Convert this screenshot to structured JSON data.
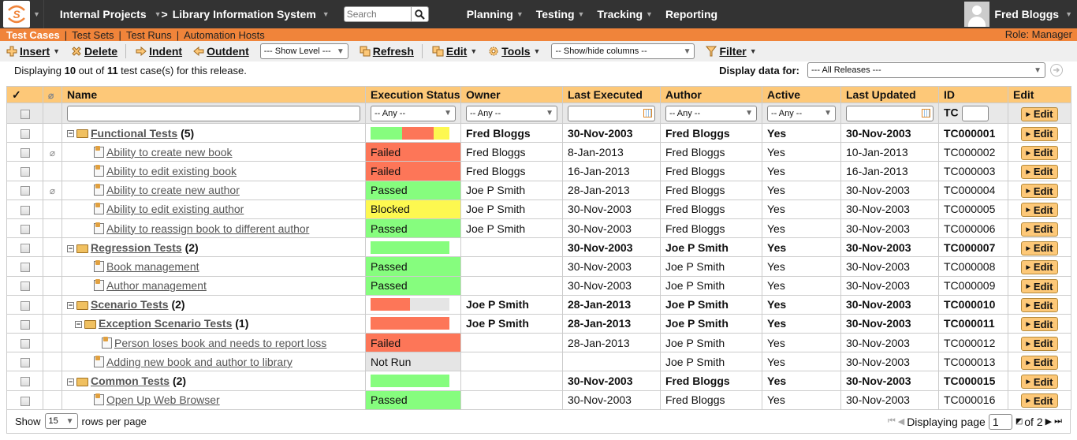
{
  "topnav": {
    "project": "Internal Projects",
    "product": "Library Information System",
    "search_placeholder": "Search",
    "menu": [
      "Planning",
      "Testing",
      "Tracking",
      "Reporting"
    ],
    "user_name": "Fred Bloggs"
  },
  "subnav": {
    "tabs": [
      "Test Cases",
      "Test Sets",
      "Test Runs",
      "Automation Hosts"
    ],
    "active_tab": "Test Cases",
    "role": "Role: Manager"
  },
  "toolbar": {
    "insert": "Insert",
    "delete": "Delete",
    "indent": "Indent",
    "outdent": "Outdent",
    "show_level": "--- Show Level ---",
    "refresh": "Refresh",
    "edit": "Edit",
    "tools": "Tools",
    "show_hide_columns": "-- Show/hide columns --",
    "filter": "Filter"
  },
  "info": {
    "prefix": "Displaying ",
    "shown": "10",
    "middle": " out of ",
    "total": "11",
    "suffix": " test case(s) for this release.",
    "display_data_for_label": "Display data for:",
    "release_select": "--- All Releases ---"
  },
  "grid": {
    "columns": [
      "✓",
      "",
      "Name",
      "Execution Status",
      "Owner",
      "Last Executed",
      "Author",
      "Active",
      "Last Updated",
      "ID",
      "Edit"
    ],
    "filters": {
      "status": "-- Any --",
      "owner": "-- Any --",
      "author": "-- Any --",
      "active": "-- Any --",
      "id_prefix": "TC",
      "edit": "Edit"
    },
    "colors": {
      "passed": "#86fd7e",
      "failed": "#fd7658",
      "blocked": "#fdf850",
      "not_run": "#e5e5e5"
    },
    "rows": [
      {
        "type": "folder",
        "level": 0,
        "name": "Functional Tests",
        "count": "(5)",
        "attach": false,
        "status_bar": [
          {
            "s": "passed",
            "pct": 40
          },
          {
            "s": "failed",
            "pct": 40
          },
          {
            "s": "blocked",
            "pct": 20
          }
        ],
        "owner": "Fred Bloggs",
        "last_executed": "30-Nov-2003",
        "author": "Fred Bloggs",
        "active": "Yes",
        "last_updated": "30-Nov-2003",
        "id": "TC000001"
      },
      {
        "type": "test",
        "level": 1,
        "name": "Ability to create new book",
        "attach": true,
        "status": "Failed",
        "status_key": "failed",
        "owner": "Fred Bloggs",
        "last_executed": "8-Jan-2013",
        "author": "Fred Bloggs",
        "active": "Yes",
        "last_updated": "10-Jan-2013",
        "id": "TC000002"
      },
      {
        "type": "test",
        "level": 1,
        "name": "Ability to edit existing book",
        "attach": false,
        "status": "Failed",
        "status_key": "failed",
        "owner": "Fred Bloggs",
        "last_executed": "16-Jan-2013",
        "author": "Fred Bloggs",
        "active": "Yes",
        "last_updated": "16-Jan-2013",
        "id": "TC000003"
      },
      {
        "type": "test",
        "level": 1,
        "name": "Ability to create new author",
        "attach": true,
        "status": "Passed",
        "status_key": "passed",
        "owner": "Joe P Smith",
        "last_executed": "28-Jan-2013",
        "author": "Fred Bloggs",
        "active": "Yes",
        "last_updated": "30-Nov-2003",
        "id": "TC000004"
      },
      {
        "type": "test",
        "level": 1,
        "name": "Ability to edit existing author",
        "attach": false,
        "status": "Blocked",
        "status_key": "blocked",
        "owner": "Joe P Smith",
        "last_executed": "30-Nov-2003",
        "author": "Fred Bloggs",
        "active": "Yes",
        "last_updated": "30-Nov-2003",
        "id": "TC000005"
      },
      {
        "type": "test",
        "level": 1,
        "name": "Ability to reassign book to different author",
        "attach": false,
        "status": "Passed",
        "status_key": "passed",
        "owner": "Joe P Smith",
        "last_executed": "30-Nov-2003",
        "author": "Fred Bloggs",
        "active": "Yes",
        "last_updated": "30-Nov-2003",
        "id": "TC000006"
      },
      {
        "type": "folder",
        "level": 0,
        "name": "Regression Tests",
        "count": "(2)",
        "attach": false,
        "status_bar": [
          {
            "s": "passed",
            "pct": 100
          }
        ],
        "owner": "",
        "last_executed": "30-Nov-2003",
        "author": "Joe P Smith",
        "active": "Yes",
        "last_updated": "30-Nov-2003",
        "id": "TC000007"
      },
      {
        "type": "test",
        "level": 1,
        "name": "Book management",
        "attach": false,
        "status": "Passed",
        "status_key": "passed",
        "owner": "",
        "last_executed": "30-Nov-2003",
        "author": "Joe P Smith",
        "active": "Yes",
        "last_updated": "30-Nov-2003",
        "id": "TC000008"
      },
      {
        "type": "test",
        "level": 1,
        "name": "Author management",
        "attach": false,
        "status": "Passed",
        "status_key": "passed",
        "owner": "",
        "last_executed": "30-Nov-2003",
        "author": "Joe P Smith",
        "active": "Yes",
        "last_updated": "30-Nov-2003",
        "id": "TC000009"
      },
      {
        "type": "folder",
        "level": 0,
        "name": "Scenario Tests",
        "count": "(2)",
        "attach": false,
        "status_bar": [
          {
            "s": "failed",
            "pct": 50
          },
          {
            "s": "not_run",
            "pct": 50
          }
        ],
        "owner": "Joe P Smith",
        "last_executed": "28-Jan-2013",
        "author": "Joe P Smith",
        "active": "Yes",
        "last_updated": "30-Nov-2003",
        "id": "TC000010"
      },
      {
        "type": "folder",
        "level": 1,
        "name": "Exception Scenario Tests",
        "count": "(1)",
        "attach": false,
        "status_bar": [
          {
            "s": "failed",
            "pct": 100
          }
        ],
        "owner": "Joe P Smith",
        "last_executed": "28-Jan-2013",
        "author": "Joe P Smith",
        "active": "Yes",
        "last_updated": "30-Nov-2003",
        "id": "TC000011"
      },
      {
        "type": "test",
        "level": 2,
        "name": "Person loses book and needs to report loss",
        "attach": false,
        "status": "Failed",
        "status_key": "failed",
        "owner": "",
        "last_executed": "28-Jan-2013",
        "author": "Joe P Smith",
        "active": "Yes",
        "last_updated": "30-Nov-2003",
        "id": "TC000012"
      },
      {
        "type": "test",
        "level": 1,
        "name": "Adding new book and author to library",
        "attach": false,
        "status": "Not Run",
        "status_key": "not_run",
        "owner": "",
        "last_executed": "",
        "author": "Joe P Smith",
        "active": "Yes",
        "last_updated": "30-Nov-2003",
        "id": "TC000013"
      },
      {
        "type": "folder",
        "level": 0,
        "name": "Common Tests",
        "count": "(2)",
        "attach": false,
        "status_bar": [
          {
            "s": "passed",
            "pct": 100
          }
        ],
        "owner": "",
        "last_executed": "30-Nov-2003",
        "author": "Fred Bloggs",
        "active": "Yes",
        "last_updated": "30-Nov-2003",
        "id": "TC000015"
      },
      {
        "type": "test",
        "level": 1,
        "name": "Open Up Web Browser",
        "attach": false,
        "status": "Passed",
        "status_key": "passed",
        "owner": "",
        "last_executed": "30-Nov-2003",
        "author": "Fred Bloggs",
        "active": "Yes",
        "last_updated": "30-Nov-2003",
        "id": "TC000016"
      }
    ],
    "edit_label": "Edit"
  },
  "footer": {
    "show": "Show",
    "rows_per_page": "15",
    "rows_per_page_suffix": "rows per page",
    "displaying_page": "Displaying page",
    "current_page": "1",
    "of_pages": "of 2"
  }
}
